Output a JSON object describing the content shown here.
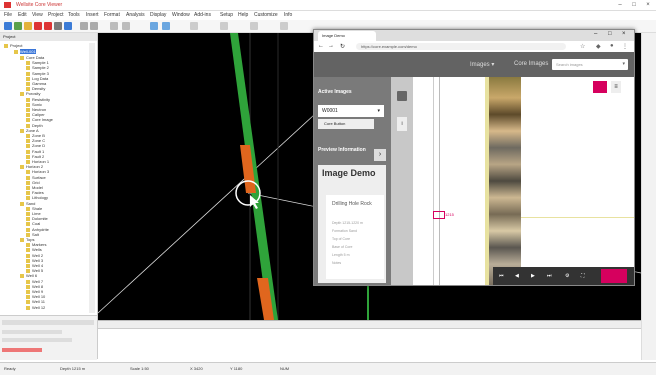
{
  "titlebar": {
    "title": "Wellsite Core Viewer"
  },
  "menu": {
    "items": [
      "File",
      "Edit",
      "View",
      "Project",
      "Tools",
      "Insert",
      "Format",
      "Analysis",
      "Display",
      "Window",
      "Add-ins",
      "Setup",
      "Help",
      "Customize",
      "Info"
    ]
  },
  "tree": {
    "root": "Project",
    "selected": "Well-001",
    "items": [
      "Core Data",
      "Sample 1",
      "Sample 2",
      "Sample 3",
      "Log Data",
      "Gamma",
      "Density",
      "Porosity",
      "Resistivity",
      "Sonic",
      "Neutron",
      "Caliper",
      "Core Image",
      "Depth",
      "Zone A",
      "Zone B",
      "Zone C",
      "Zone D",
      "Fault 1",
      "Fault 2",
      "Horizon 1",
      "Horizon 2",
      "Horizon 3",
      "Surface",
      "Grid",
      "Model",
      "Facies",
      "Lithology",
      "Sand",
      "Shale",
      "Lime",
      "Dolomite",
      "Coal",
      "Anhydrite",
      "Salt",
      "Tops",
      "Markers",
      "Wells",
      "Well 2",
      "Well 3",
      "Well 4",
      "Well 5",
      "Well 6",
      "Well 7",
      "Well 8",
      "Well 9",
      "Well 10",
      "Well 11",
      "Well 12",
      "Results"
    ]
  },
  "browser": {
    "tab_title": "Image Demo",
    "url": "https://core.example.com/demo",
    "nav_label": "Images",
    "nav_link": "Core Images",
    "search_placeholder": "Search images",
    "active_images_label": "Active Images",
    "well_select": "W0001",
    "core_button": "Core Button",
    "preview_label": "Preview Information",
    "demo_title": "Image Demo",
    "card_title": "Drilling Hole Rock",
    "card_rows": [
      "Depth 1215-1220 m",
      "Formation  Sand",
      "Top of Core",
      "Base of Core",
      "Length 5 m",
      "Notes"
    ],
    "ruler_label": "1215"
  },
  "statusbar": {
    "items": [
      "Ready",
      "Depth 1215 m",
      "Scale 1:50",
      "X 3420",
      "Y 1180",
      "NUM"
    ]
  },
  "colors": {
    "accent": "#d6005e",
    "core_green": "#2fa33a",
    "core_orange": "#e0661e"
  }
}
